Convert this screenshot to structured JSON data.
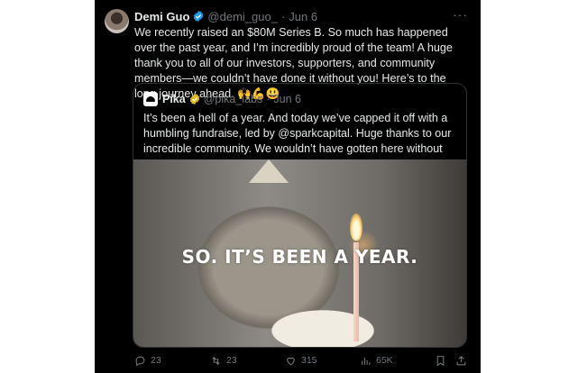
{
  "author": {
    "name": "Demi Guo",
    "handle": "@demi_guo_",
    "separator": "·",
    "date": "Jun 6",
    "more": "···"
  },
  "tweet": {
    "text": "We recently raised an $80M Series B. So much has happened over the past year, and I’m incredibly proud of the team! A huge thank you to all of our investors, supporters, and community members—we couldn’t have done it without you!  Here’s to the long journey ahead. 🙌💪😃"
  },
  "quote": {
    "name": "Pika",
    "handle": "@pika_labs",
    "separator": "·",
    "date": "Jun 6",
    "text": "It’s been a hell of a year. And today we’ve capped it off with a humbling fundraise, led by @sparkcapital. Huge thanks to our incredible community. We wouldn’t have gotten here without you!",
    "image_caption": "SO. IT’S BEEN A YEAR."
  },
  "actions": {
    "replies": "23",
    "reposts": "23",
    "likes": "315",
    "views": "65K",
    "icons": [
      "reply-icon",
      "repost-icon",
      "like-icon",
      "views-icon",
      "bookmark-icon",
      "share-icon"
    ]
  },
  "colors": {
    "background": "#000000",
    "text": "#e7e9ea",
    "muted": "#71767b",
    "verified_blue": "#1d9bf0",
    "verified_gold": "#e2b719"
  }
}
